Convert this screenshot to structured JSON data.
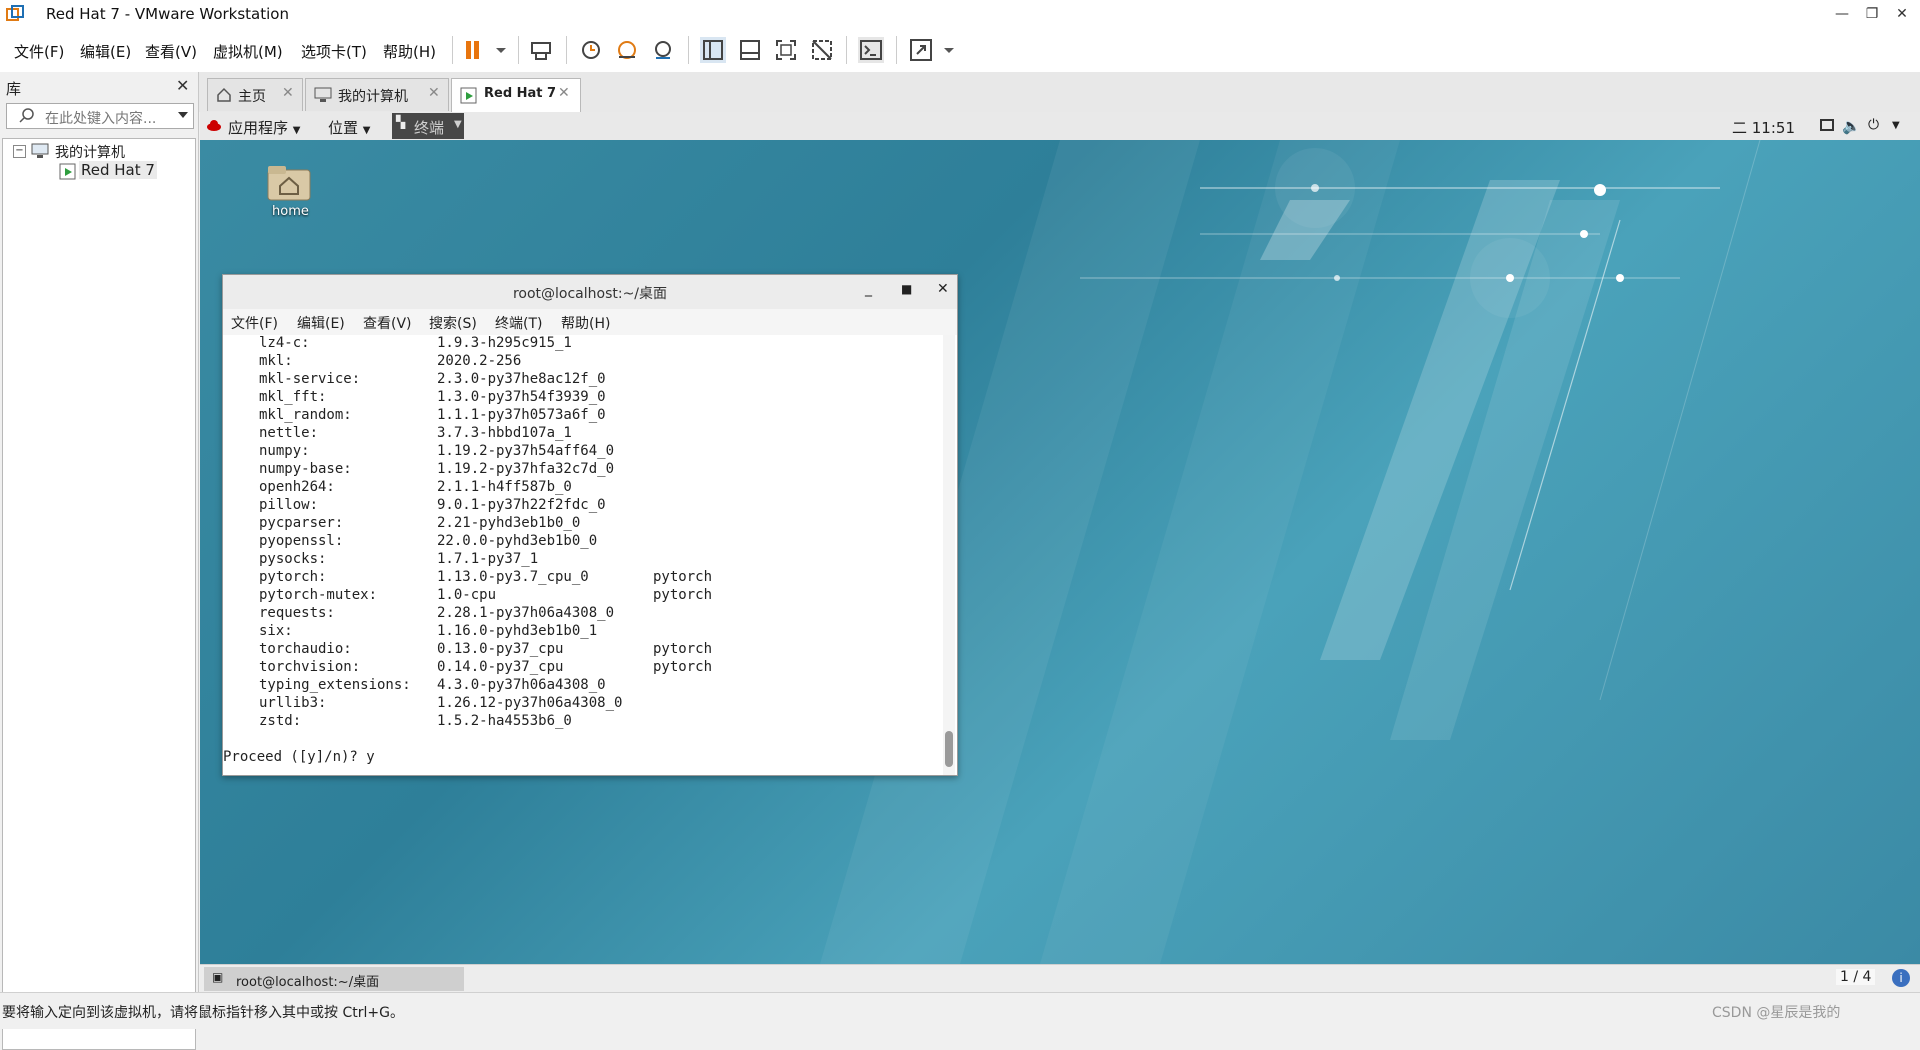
{
  "window": {
    "title": "Red Hat 7 - VMware Workstation"
  },
  "menubar": [
    "文件(F)",
    "编辑(E)",
    "查看(V)",
    "虚拟机(M)",
    "选项卡(T)",
    "帮助(H)"
  ],
  "library": {
    "header": "库",
    "search_placeholder": "在此处键入内容...",
    "tree_root": "我的计算机",
    "tree_child": "Red Hat 7"
  },
  "tabs": [
    {
      "label": "主页"
    },
    {
      "label": "我的计算机"
    },
    {
      "label": "Red Hat 7"
    }
  ],
  "gnome": {
    "apps": "应用程序",
    "places": "位置",
    "terminal": "终端",
    "clock": "二 11:51"
  },
  "desktop": {
    "home_label": "home"
  },
  "terminal": {
    "title": "root@localhost:~/桌面",
    "menu": [
      "文件(F)",
      "编辑(E)",
      "查看(V)",
      "搜索(S)",
      "终端(T)",
      "帮助(H)"
    ],
    "packages": [
      {
        "name": "lz4-c:",
        "version": "1.9.3-h295c915_1",
        "channel": ""
      },
      {
        "name": "mkl:",
        "version": "2020.2-256",
        "channel": ""
      },
      {
        "name": "mkl-service:",
        "version": "2.3.0-py37he8ac12f_0",
        "channel": ""
      },
      {
        "name": "mkl_fft:",
        "version": "1.3.0-py37h54f3939_0",
        "channel": ""
      },
      {
        "name": "mkl_random:",
        "version": "1.1.1-py37h0573a6f_0",
        "channel": ""
      },
      {
        "name": "nettle:",
        "version": "3.7.3-hbbd107a_1",
        "channel": ""
      },
      {
        "name": "numpy:",
        "version": "1.19.2-py37h54aff64_0",
        "channel": ""
      },
      {
        "name": "numpy-base:",
        "version": "1.19.2-py37hfa32c7d_0",
        "channel": ""
      },
      {
        "name": "openh264:",
        "version": "2.1.1-h4ff587b_0",
        "channel": ""
      },
      {
        "name": "pillow:",
        "version": "9.0.1-py37h22f2fdc_0",
        "channel": ""
      },
      {
        "name": "pycparser:",
        "version": "2.21-pyhd3eb1b0_0",
        "channel": ""
      },
      {
        "name": "pyopenssl:",
        "version": "22.0.0-pyhd3eb1b0_0",
        "channel": ""
      },
      {
        "name": "pysocks:",
        "version": "1.7.1-py37_1",
        "channel": ""
      },
      {
        "name": "pytorch:",
        "version": "1.13.0-py3.7_cpu_0",
        "channel": "pytorch"
      },
      {
        "name": "pytorch-mutex:",
        "version": "1.0-cpu",
        "channel": "pytorch"
      },
      {
        "name": "requests:",
        "version": "2.28.1-py37h06a4308_0",
        "channel": ""
      },
      {
        "name": "six:",
        "version": "1.16.0-pyhd3eb1b0_1",
        "channel": ""
      },
      {
        "name": "torchaudio:",
        "version": "0.13.0-py37_cpu",
        "channel": "pytorch"
      },
      {
        "name": "torchvision:",
        "version": "0.14.0-py37_cpu",
        "channel": "pytorch"
      },
      {
        "name": "typing_extensions:",
        "version": "4.3.0-py37h06a4308_0",
        "channel": ""
      },
      {
        "name": "urllib3:",
        "version": "1.26.12-py37h06a4308_0",
        "channel": ""
      },
      {
        "name": "zstd:",
        "version": "1.5.2-ha4553b6_0",
        "channel": ""
      }
    ],
    "prompt": "Proceed ([y]/n)? y"
  },
  "vm_taskbar": {
    "item": "root@localhost:~/桌面",
    "pager": "1 / 4"
  },
  "statusbar": {
    "message": "要将输入定向到该虚拟机，请将鼠标指针移入其中或按 Ctrl+G。",
    "watermark": "CSDN @星辰是我的"
  }
}
